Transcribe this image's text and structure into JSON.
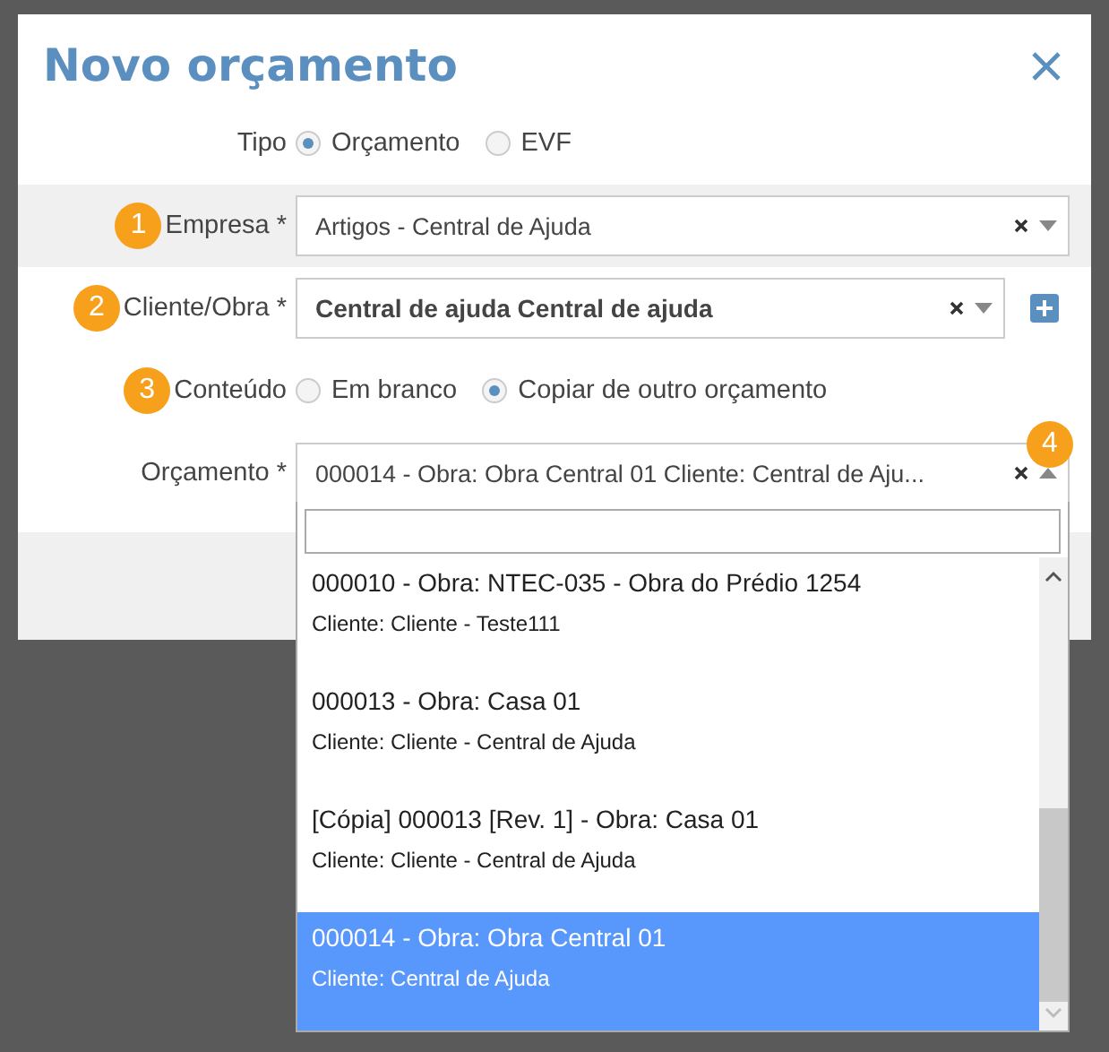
{
  "dialog": {
    "title": "Novo orçamento"
  },
  "fields": [
    {
      "kind": "radio",
      "label": "Tipo",
      "options": [
        {
          "label": "Orçamento",
          "selected": true
        },
        {
          "label": "EVF",
          "selected": false
        }
      ]
    },
    {
      "kind": "select",
      "label": "Empresa *",
      "badge": "1",
      "value": "Artigos - Central de Ajuda",
      "bold": false,
      "shaded": true,
      "add_button": false,
      "open": false
    },
    {
      "kind": "select",
      "label": "Cliente/Obra *",
      "badge": "2",
      "value": "Central de ajuda Central de ajuda",
      "bold": true,
      "shaded": false,
      "add_button": true,
      "open": false
    },
    {
      "kind": "radio",
      "label": "Conteúdo",
      "badge": "3",
      "options": [
        {
          "label": "Em branco",
          "selected": false
        },
        {
          "label": "Copiar de outro orçamento",
          "selected": true
        }
      ]
    },
    {
      "kind": "select",
      "label": "Orçamento *",
      "badge": "4",
      "value": "000014 - Obra: Obra Central 01 Cliente: Central de Aju...",
      "bold": false,
      "shaded": false,
      "add_button": false,
      "open": true
    }
  ],
  "dropdown": {
    "options": [
      {
        "title": "000010 - Obra: NTEC-035 - Obra do Prédio 1254",
        "subtitle": "Cliente: Cliente - Teste111",
        "selected": false
      },
      {
        "title": "000013 - Obra: Casa 01",
        "subtitle": "Cliente: Cliente - Central de Ajuda",
        "selected": false
      },
      {
        "title": "[Cópia] 000013 [Rev. 1] - Obra: Casa 01",
        "subtitle": "Cliente: Cliente - Central de Ajuda",
        "selected": false
      },
      {
        "title": "000014 - Obra: Obra Central 01",
        "subtitle": "Cliente: Central de Ajuda",
        "selected": true
      }
    ]
  }
}
